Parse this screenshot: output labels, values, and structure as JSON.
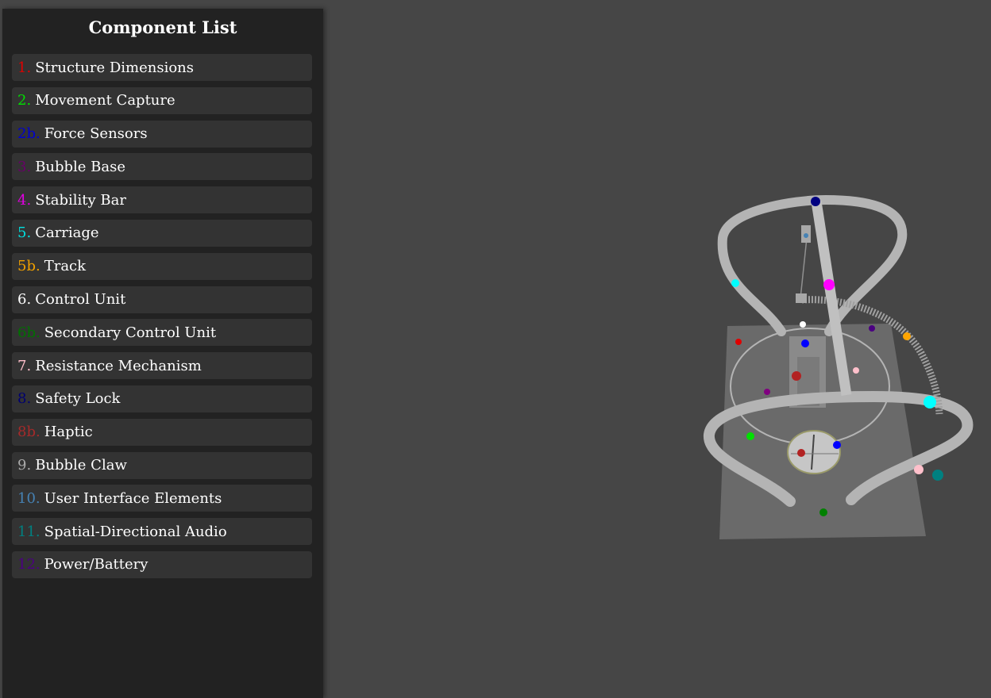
{
  "panel": {
    "title": "Component List",
    "items": [
      {
        "num": "1.",
        "label": "Structure Dimensions",
        "color": "#e00000"
      },
      {
        "num": "2.",
        "label": "Movement Capture",
        "color": "#00e000"
      },
      {
        "num": "2b.",
        "label": "Force Sensors",
        "color": "#0000d0"
      },
      {
        "num": "3.",
        "label": "Bubble Base",
        "color": "#6a006a"
      },
      {
        "num": "4.",
        "label": "Stability Bar",
        "color": "#e000e0"
      },
      {
        "num": "5.",
        "label": "Carriage",
        "color": "#00e0e0"
      },
      {
        "num": "5b.",
        "label": "Track",
        "color": "#f0a000"
      },
      {
        "num": "6.",
        "label": "Control Unit",
        "color": "#ffffff"
      },
      {
        "num": "6b.",
        "label": "Secondary Control Unit",
        "color": "#007000"
      },
      {
        "num": "7.",
        "label": "Resistance Mechanism",
        "color": "#ffc0cb"
      },
      {
        "num": "8.",
        "label": "Safety Lock",
        "color": "#000070"
      },
      {
        "num": "8b.",
        "label": "Haptic",
        "color": "#a52a2a"
      },
      {
        "num": "9.",
        "label": "Bubble Claw",
        "color": "#aaaaaa"
      },
      {
        "num": "10.",
        "label": "User Interface Elements",
        "color": "#4682b4"
      },
      {
        "num": "11.",
        "label": "Spatial-Directional Audio",
        "color": "#008080"
      },
      {
        "num": "12.",
        "label": "Power/Battery",
        "color": "#4b0082"
      }
    ]
  },
  "scene": {
    "background": "#464646",
    "structure_color": "#b4b4b4",
    "base_color": "#6a6a6a"
  }
}
